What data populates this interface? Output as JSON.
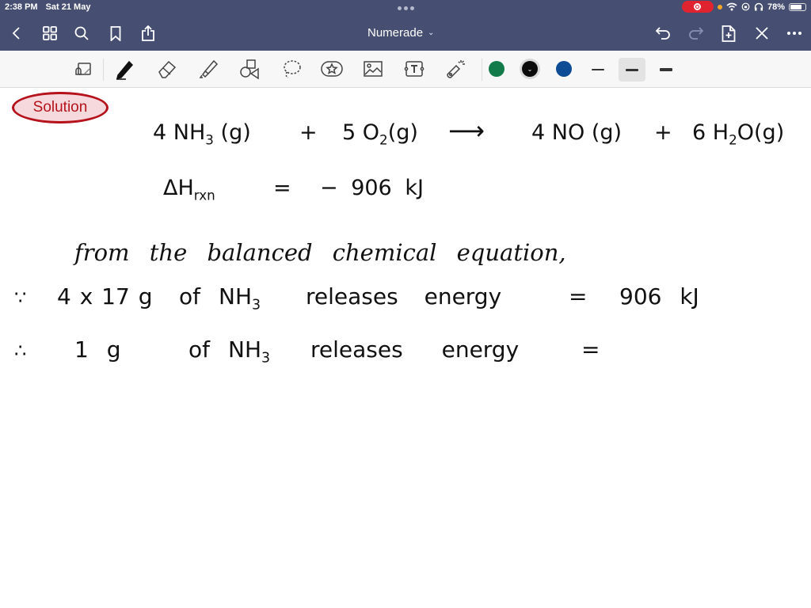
{
  "status_bar": {
    "time": "2:38 PM",
    "date": "Sat 21 May",
    "battery_percent": "78%",
    "battery_level": 0.78,
    "icons": [
      "screen-recording-icon",
      "orange-privacy-dot",
      "wifi-icon",
      "lock-rotation-icon",
      "headphones-icon",
      "battery-icon"
    ]
  },
  "nav_bar": {
    "title": "Numerade",
    "title_chevron": "⌄",
    "left_icons": [
      "back-icon",
      "thumbnails-grid-icon",
      "search-icon",
      "bookmark-icon",
      "share-icon"
    ],
    "right_icons": [
      "undo-icon",
      "redo-icon",
      "add-page-icon",
      "close-pen-icon",
      "more-icon"
    ]
  },
  "toolbar": {
    "tools": [
      "read-only-mode-icon",
      "pen-icon",
      "eraser-icon",
      "highlighter-icon",
      "shapes-icon",
      "lasso-icon",
      "sticker-icon",
      "image-icon",
      "text-box-icon",
      "laser-pointer-icon"
    ],
    "bluetooth_glyph": "✱",
    "colors": [
      {
        "name": "green",
        "hex": "#137a4a",
        "selected": false
      },
      {
        "name": "black",
        "hex": "#0b0b0b",
        "selected": true
      },
      {
        "name": "blue",
        "hex": "#0f4c96",
        "selected": false
      }
    ],
    "selected_color_glyph": "⌄",
    "stroke_widths": [
      {
        "name": "fine",
        "selected": false
      },
      {
        "name": "medium",
        "selected": true
      },
      {
        "name": "thick",
        "selected": false
      }
    ]
  },
  "note": {
    "badge": "Solution",
    "equation": {
      "r1_coef": "4",
      "r1_formula": "NH",
      "r1_sub": "3",
      "r1_state": "(g)",
      "plus1": "+",
      "r2_coef": "5",
      "r2_formula": "O",
      "r2_sub": "2",
      "r2_state": "(g)",
      "arrow": "⟶",
      "p1_coef": "4",
      "p1_formula": "NO",
      "p1_state": "(g)",
      "plus2": "+",
      "p2_coef": "6",
      "p2_formula_a": "H",
      "p2_sub": "2",
      "p2_formula_b": "O",
      "p2_state": "(g)"
    },
    "enthalpy": {
      "symbol": "ΔH",
      "subscript": "rxn",
      "equals": "=",
      "value": "− 906 kJ"
    },
    "line_intro": "from the balanced chemical equation,",
    "line_a": {
      "symbol": "∵",
      "mass": "4 x 17 g",
      "of": "of",
      "formula": "NH",
      "sub": "3",
      "text": "releases energy",
      "equals": "=",
      "value": "906 kJ"
    },
    "line_b": {
      "symbol": "∴",
      "mass": "1 g",
      "of": "of",
      "formula": "NH",
      "sub": "3",
      "text": "releases energy",
      "equals": "="
    }
  }
}
